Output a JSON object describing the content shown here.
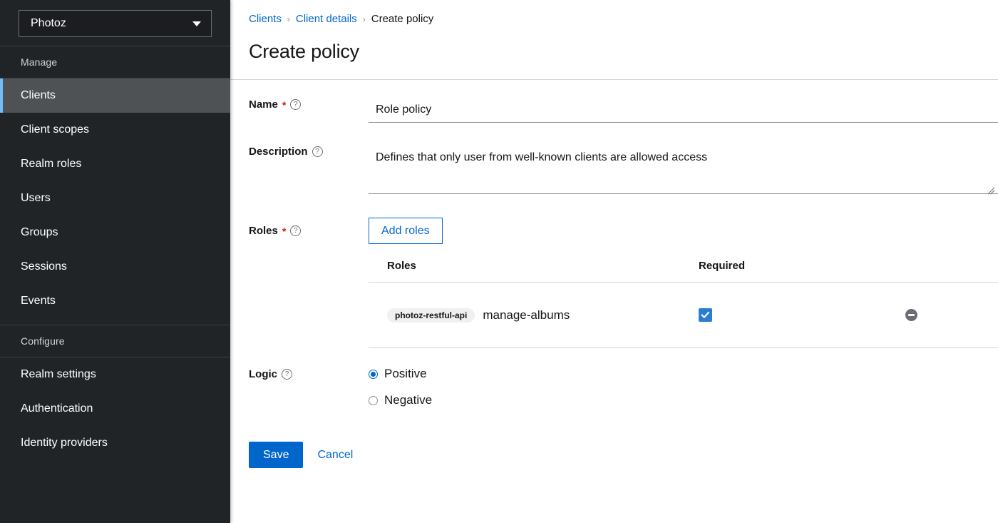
{
  "sidebar": {
    "realm_selector": {
      "value": "Photoz",
      "icon": "chevron-down-icon"
    },
    "groups": [
      {
        "title": "Manage",
        "items": [
          {
            "label": "Clients",
            "selected": true
          },
          {
            "label": "Client scopes",
            "selected": false
          },
          {
            "label": "Realm roles",
            "selected": false
          },
          {
            "label": "Users",
            "selected": false
          },
          {
            "label": "Groups",
            "selected": false
          },
          {
            "label": "Sessions",
            "selected": false
          },
          {
            "label": "Events",
            "selected": false
          }
        ]
      },
      {
        "title": "Configure",
        "items": [
          {
            "label": "Realm settings",
            "selected": false
          },
          {
            "label": "Authentication",
            "selected": false
          },
          {
            "label": "Identity providers",
            "selected": false
          }
        ]
      }
    ]
  },
  "breadcrumb": {
    "items": [
      {
        "label": "Clients",
        "link": true
      },
      {
        "label": "Client details",
        "link": true
      },
      {
        "label": "Create policy",
        "link": false
      }
    ],
    "separator": "›"
  },
  "page": {
    "title": "Create policy"
  },
  "form": {
    "name": {
      "label": "Name",
      "required_marker": "*",
      "help_icon": "question-circle-icon",
      "value": "Role policy",
      "placeholder": ""
    },
    "description": {
      "label": "Description",
      "help_icon": "question-circle-icon",
      "value": "Defines that only user from well-known clients are allowed access",
      "placeholder": ""
    },
    "roles": {
      "label": "Roles",
      "required_marker": "*",
      "help_icon": "question-circle-icon",
      "add_button_label": "Add roles",
      "columns": {
        "roles": "Roles",
        "required": "Required",
        "actions": ""
      },
      "rows": [
        {
          "client_badge": "photoz-restful-api",
          "role_name": "manage-albums",
          "required_checked": true,
          "remove_icon": "minus-circle-icon"
        }
      ]
    },
    "logic": {
      "label": "Logic",
      "help_icon": "question-circle-icon",
      "options": [
        {
          "label": "Positive",
          "selected": true
        },
        {
          "label": "Negative",
          "selected": false
        }
      ]
    }
  },
  "actions": {
    "save_label": "Save",
    "cancel_label": "Cancel"
  },
  "colors": {
    "accent_blue": "#06c",
    "sidebar_bg": "#212427",
    "sidebar_selected_bg": "#4f5255",
    "sidebar_accent": "#73bcf7",
    "required_red": "#c9190b",
    "checkbox_blue": "#2b7cd3",
    "badge_bg": "#f0f0f0"
  }
}
